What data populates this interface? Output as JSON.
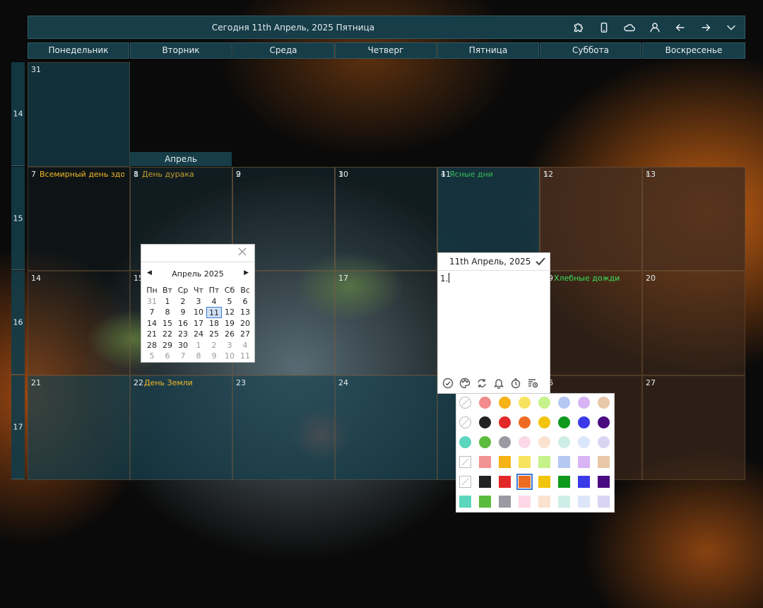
{
  "header": {
    "title": "Сегодня 11th Апрель, 2025 Пятница",
    "icons": [
      "puzzle-icon",
      "phone-icon",
      "cloud-icon",
      "user-icon",
      "arrow-left-icon",
      "arrow-right-icon",
      "chevron-down-icon"
    ]
  },
  "days": [
    "Понедельник",
    "Вторник",
    "Среда",
    "Четверг",
    "Пятница",
    "Суббота",
    "Воскресенье"
  ],
  "weeks": [
    "14",
    "15",
    "16",
    "17"
  ],
  "month_label": "Апрель",
  "cells": [
    {
      "num": "31",
      "event": "",
      "color": ""
    },
    {
      "num": "1",
      "event": "День дурака",
      "color": "yellow"
    },
    {
      "num": "2",
      "event": "",
      "color": ""
    },
    {
      "num": "3",
      "event": "",
      "color": ""
    },
    {
      "num": "4",
      "event": "Ясные дни",
      "color": "green"
    },
    {
      "num": "5",
      "event": "",
      "color": ""
    },
    {
      "num": "6",
      "event": "",
      "color": ""
    },
    {
      "num": "7",
      "event": "Всемирный день здор",
      "color": "yellow"
    },
    {
      "num": "8",
      "event": "",
      "color": ""
    },
    {
      "num": "9",
      "event": "",
      "color": ""
    },
    {
      "num": "10",
      "event": "",
      "color": ""
    },
    {
      "num": "11",
      "event": "",
      "color": ""
    },
    {
      "num": "12",
      "event": "",
      "color": ""
    },
    {
      "num": "13",
      "event": "",
      "color": ""
    },
    {
      "num": "14",
      "event": "",
      "color": ""
    },
    {
      "num": "15",
      "event": "",
      "color": ""
    },
    {
      "num": "16",
      "event": "",
      "color": ""
    },
    {
      "num": "17",
      "event": "",
      "color": ""
    },
    {
      "num": "18",
      "event": "",
      "color": ""
    },
    {
      "num": "19",
      "event": "Хлебные дожди",
      "color": "green"
    },
    {
      "num": "20",
      "event": "",
      "color": ""
    },
    {
      "num": "21",
      "event": "",
      "color": ""
    },
    {
      "num": "22",
      "event": "День Земли",
      "color": "yellow"
    },
    {
      "num": "23",
      "event": "",
      "color": ""
    },
    {
      "num": "24",
      "event": "",
      "color": ""
    },
    {
      "num": "25",
      "event": "",
      "color": ""
    },
    {
      "num": "26",
      "event": "",
      "color": ""
    },
    {
      "num": "27",
      "event": "",
      "color": ""
    }
  ],
  "mini_calendar": {
    "month": "Апрель 2025",
    "weekdays": [
      "Пн",
      "Вт",
      "Ср",
      "Чт",
      "Пт",
      "Сб",
      "Вс"
    ],
    "rows": [
      [
        "31",
        "1",
        "2",
        "3",
        "4",
        "5",
        "6"
      ],
      [
        "7",
        "8",
        "9",
        "10",
        "11",
        "12",
        "13"
      ],
      [
        "14",
        "15",
        "16",
        "17",
        "18",
        "19",
        "20"
      ],
      [
        "21",
        "22",
        "23",
        "24",
        "25",
        "26",
        "27"
      ],
      [
        "28",
        "29",
        "30",
        "1",
        "2",
        "3",
        "4"
      ],
      [
        "5",
        "6",
        "7",
        "8",
        "9",
        "10",
        "11"
      ]
    ],
    "today": "11"
  },
  "note": {
    "date": "11th Апрель, 2025",
    "text": "1.",
    "tools": [
      "check-circle-icon",
      "palette-icon",
      "repeat-icon",
      "bell-icon",
      "timer-icon",
      "list-clock-icon"
    ]
  },
  "palette": {
    "rows": [
      [
        "none",
        "#f28b8b",
        "#f5b316",
        "#f7e35e",
        "#c5f28a",
        "#b5c8f2",
        "#d8b4f5",
        "#e8c8a8"
      ],
      [
        "none2",
        "#222222",
        "#e32828",
        "#ee6c22",
        "#f2c40c",
        "#0f9a1e",
        "#3a3ae8",
        "#4a0a80"
      ],
      [
        "#5cd6be",
        "#5abb3c",
        "#9a9aa2",
        "#fcd8e6",
        "#fbe2d0",
        "#cdeee6",
        "#dce6fa",
        "#d8d4f2"
      ],
      [
        "none",
        "#f29292",
        "#f5b316",
        "#f7e35e",
        "#c5f28a",
        "#b5c8f2",
        "#d8b4f5",
        "#e8c8a8"
      ],
      [
        "none2",
        "#222222",
        "#e32828",
        "#ee6c22",
        "#f2c40c",
        "#0f9a1e",
        "#3a3ae8",
        "#4a0a80"
      ],
      [
        "#5cd6be",
        "#5abb3c",
        "#9a9aa2",
        "#fcd8e6",
        "#fbe2d0",
        "#cdeee6",
        "#dce6fa",
        "#d8d4f2"
      ]
    ],
    "selected": "#ee6c22"
  }
}
